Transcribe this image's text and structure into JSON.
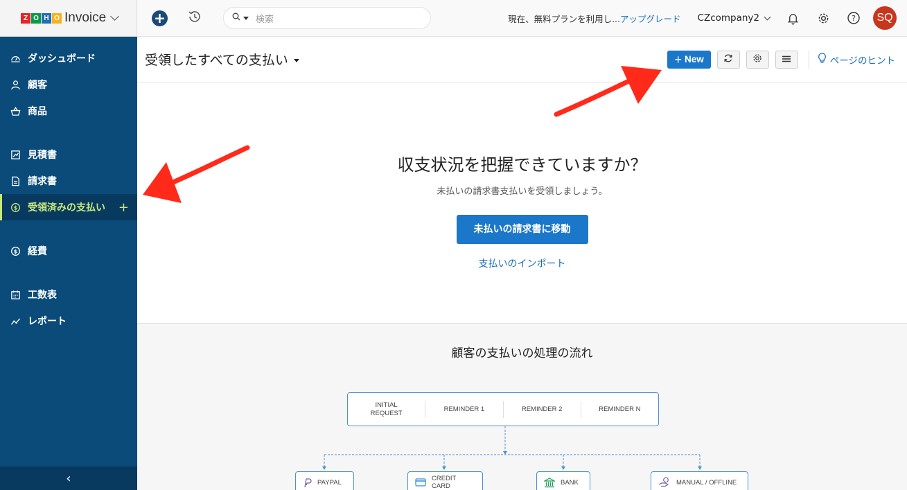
{
  "brand": {
    "logo_letters": [
      "Z",
      "O",
      "H",
      "O"
    ],
    "logo_colors": [
      "#e42527",
      "#089949",
      "#226db4",
      "#f9b21d"
    ],
    "product": "Invoice"
  },
  "sidebar": {
    "items": [
      {
        "label": "ダッシュボード",
        "icon": "dashboard-icon"
      },
      {
        "label": "顧客",
        "icon": "user-icon"
      },
      {
        "label": "商品",
        "icon": "basket-icon"
      },
      {
        "label": "見積書",
        "icon": "estimate-icon"
      },
      {
        "label": "請求書",
        "icon": "invoice-icon"
      },
      {
        "label": "受領済みの支払い",
        "icon": "payment-icon",
        "active": true,
        "plus": "+"
      },
      {
        "label": "経費",
        "icon": "expense-icon"
      },
      {
        "label": "工数表",
        "icon": "calendar-icon"
      },
      {
        "label": "レポート",
        "icon": "chart-icon"
      }
    ],
    "collapse_glyph": "‹"
  },
  "topbar": {
    "search_placeholder": "検索",
    "plan_text": "現在、無料プランを利用し...",
    "upgrade_link": "アップグレード",
    "org_name": "CZcompany2",
    "avatar_initials": "SQ"
  },
  "page": {
    "title": "受領したすべての支払い",
    "new_button": "New",
    "hint_link": "ページのヒント"
  },
  "empty_state": {
    "title": "収支状況を把握できていますか？",
    "subtitle": "未払いの請求書支払いを受領しましょう。",
    "primary_button": "未払いの請求書に移動",
    "import_link": "支払いのインポート"
  },
  "flow": {
    "title": "顧客の支払いの処理の流れ",
    "steps": [
      {
        "line1": "INITIAL",
        "line2": "REQUEST"
      },
      {
        "line1": "REMINDER 1",
        "line2": ""
      },
      {
        "line1": "REMINDER 2",
        "line2": ""
      },
      {
        "line1": "REMINDER N",
        "line2": ""
      }
    ],
    "methods": [
      {
        "label": "PAYPAL",
        "icon": "paypal-icon"
      },
      {
        "label": "CREDIT CARD",
        "icon": "credit-card-icon"
      },
      {
        "label": "BANK",
        "icon": "bank-icon"
      },
      {
        "label": "MANUAL / OFFLINE",
        "icon": "hand-money-icon"
      }
    ]
  },
  "colors": {
    "sidebar": "#0a4b7a",
    "active_accent": "#c7e97c",
    "primary": "#1b77c9",
    "annotation_arrow": "#ff2a1a",
    "avatar": "#c8361d"
  }
}
